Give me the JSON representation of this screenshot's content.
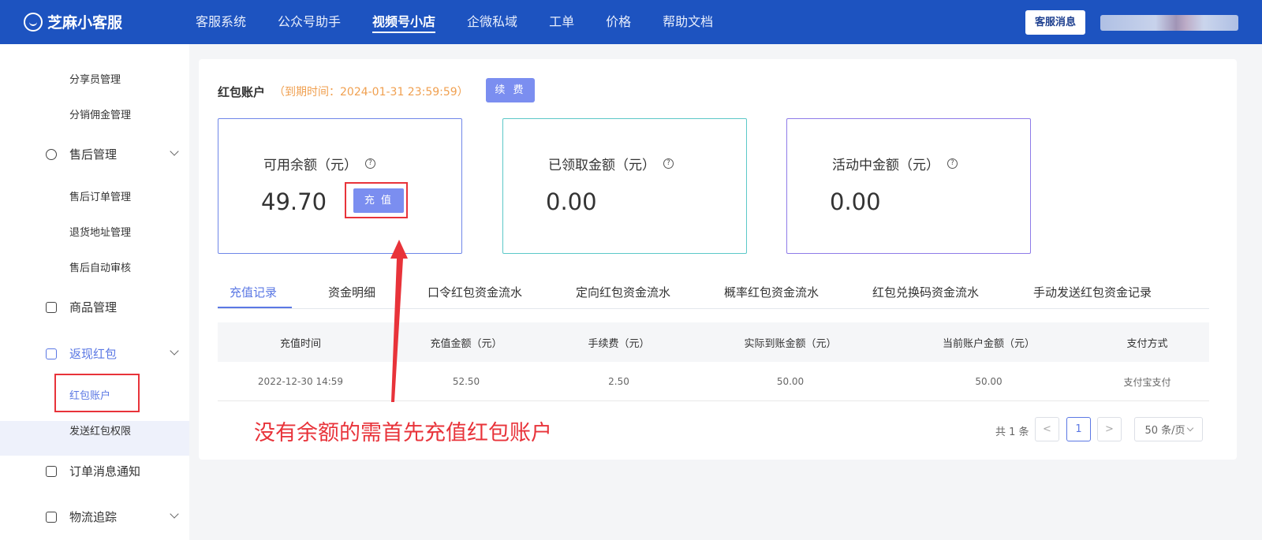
{
  "header": {
    "logo_text": "芝麻小客服",
    "nav": [
      "客服系统",
      "公众号助手",
      "视频号小店",
      "企微私域",
      "工单",
      "价格",
      "帮助文档"
    ],
    "active_nav": "视频号小店",
    "message_button": "客服消息"
  },
  "sidebar": {
    "items": [
      {
        "label": "分享员管理"
      },
      {
        "label": "分销佣金管理"
      },
      {
        "label": "售后管理"
      },
      {
        "label": "售后订单管理"
      },
      {
        "label": "退货地址管理"
      },
      {
        "label": "售后自动审核"
      },
      {
        "label": "商品管理"
      },
      {
        "label": "返现红包"
      },
      {
        "label": "红包账户"
      },
      {
        "label": "发送红包权限"
      },
      {
        "label": "订单消息通知"
      },
      {
        "label": "物流追踪"
      }
    ]
  },
  "account": {
    "title": "红包账户",
    "expiry": "（到期时间：2024-01-31 23:59:59）",
    "renew_button": "续 费"
  },
  "cards": [
    {
      "label": "可用余额（元）",
      "value": "49.70",
      "border_color": "#6f86e8"
    },
    {
      "label": "已领取金额（元）",
      "value": "0.00",
      "border_color": "#5cc8c8"
    },
    {
      "label": "活动中金额（元）",
      "value": "0.00",
      "border_color": "#8e7be8"
    }
  ],
  "charge_button": "充 值",
  "help_glyph": "?",
  "tabs": [
    "充值记录",
    "资金明细",
    "口令红包资金流水",
    "定向红包资金流水",
    "概率红包资金流水",
    "红包兑换码资金流水",
    "手动发送红包资金记录"
  ],
  "active_tab": "充值记录",
  "table": {
    "columns": [
      "充值时间",
      "充值金额（元）",
      "手续费（元）",
      "实际到账金额（元）",
      "当前账户金额（元）",
      "支付方式"
    ],
    "rows": [
      [
        "2022-12-30 14:59",
        "52.50",
        "2.50",
        "50.00",
        "50.00",
        "支付宝支付"
      ]
    ]
  },
  "annotation": "没有余额的需首先充值红包账户",
  "pagination": {
    "total": "共 1 条",
    "prev": "<",
    "current_page": "1",
    "next": ">",
    "page_size": "50 条/页"
  }
}
